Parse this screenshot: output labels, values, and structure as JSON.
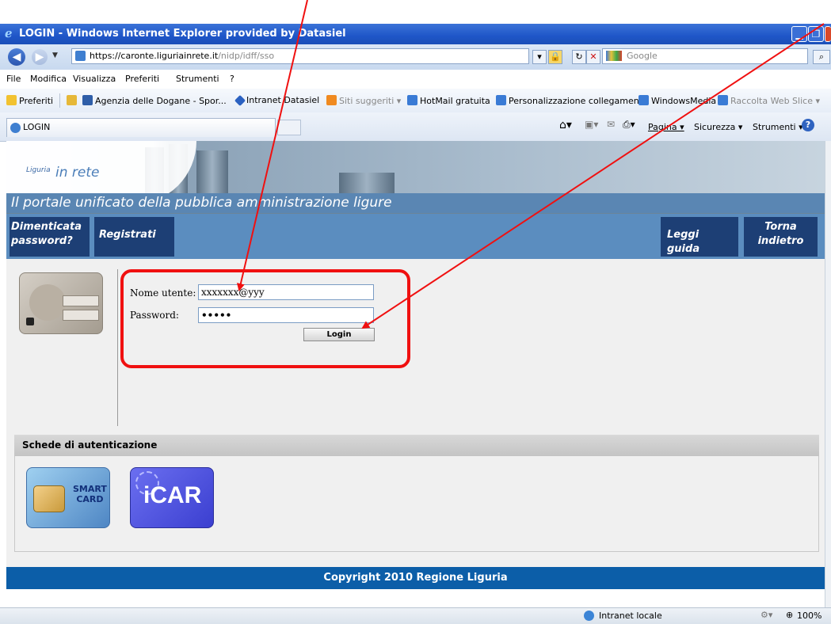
{
  "window": {
    "title": "LOGIN - Windows Internet Explorer provided by Datasiel",
    "url_main": "https://caronte.liguriainrete.it",
    "url_path": "/nidp/idff/sso",
    "search_placeholder": "Google"
  },
  "menu": [
    "File",
    "Modifica",
    "Visualizza",
    "Preferiti",
    "Strumenti",
    "?"
  ],
  "favorites": {
    "label": "Preferiti",
    "items": [
      "Agenzia delle Dogane - Spor...",
      "Intranet Datasiel",
      "Siti suggeriti ▾",
      "HotMail gratuita",
      "Personalizzazione collegamenti",
      "WindowsMedia",
      "Raccolta Web Slice ▾"
    ]
  },
  "tab": {
    "label": "LOGIN"
  },
  "commands": [
    "Pagina ▾",
    "Sicurezza ▾",
    "Strumenti ▾"
  ],
  "site": {
    "logo_small": "Liguria",
    "logo_big": "in rete",
    "subtitle": "Il portale unificato della pubblica amministrazione ligure",
    "nav": {
      "forgot_line1": "Dimenticata",
      "forgot_line2": "password?",
      "register": "Registrati",
      "guide": "Leggi guida",
      "back_line1": "Torna",
      "back_line2": "indietro"
    }
  },
  "login": {
    "username_label": "Nome utente:",
    "username_value": "xxxxxxx@yyy",
    "password_label": "Password:",
    "password_value": "•••••",
    "button": "Login"
  },
  "schede": {
    "title": "Schede di autenticazione",
    "smart_card_line1": "SMART",
    "smart_card_line2": "CARD",
    "icar": "iCAR"
  },
  "footer": "Copyright 2010 Regione Liguria",
  "status": {
    "zone": "Intranet locale",
    "zoom": "100%"
  },
  "colors": {
    "annotation_red": "#f01010",
    "nav_dark": "#1d3f75",
    "nav_band": "#5b8dbf",
    "footer_blue": "#0c5ea8"
  }
}
